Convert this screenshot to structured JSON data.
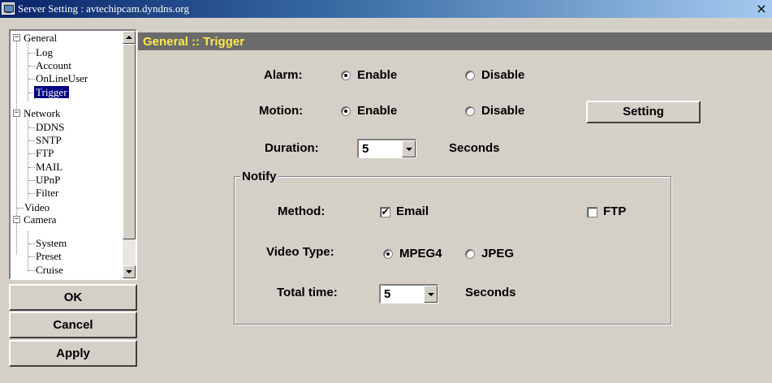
{
  "window": {
    "title": "Server Setting : avtechipcam.dyndns.org",
    "close_glyph": "×",
    "icon": "app-window-icon"
  },
  "tree": {
    "general": {
      "label": "General",
      "expander": "−",
      "children": [
        "Log",
        "Account",
        "OnLineUser",
        "Trigger"
      ]
    },
    "network": {
      "label": "Network",
      "expander": "−",
      "children": [
        "DDNS",
        "SNTP",
        "FTP",
        "MAIL",
        "UPnP",
        "Filter"
      ]
    },
    "video": {
      "label": "Video"
    },
    "camera": {
      "label": "Camera",
      "expander": "−",
      "children": [
        "System",
        "Preset",
        "Cruise"
      ]
    },
    "selected": "Trigger",
    "scroll_position": 0.0
  },
  "side_buttons": {
    "ok": "OK",
    "cancel": "Cancel",
    "apply": "Apply"
  },
  "header": {
    "text": "General :: Trigger",
    "text_color": "#ffe84a",
    "bg_color": "#6b6b6b"
  },
  "form": {
    "alarm": {
      "label": "Alarm:",
      "options": [
        "Enable",
        "Disable"
      ],
      "selected": "Enable"
    },
    "motion": {
      "label": "Motion:",
      "options": [
        "Enable",
        "Disable"
      ],
      "selected": "Enable",
      "button": "Setting"
    },
    "duration": {
      "label": "Duration:",
      "value": "5",
      "unit": "Seconds"
    }
  },
  "notify": {
    "legend": "Notify",
    "method": {
      "label": "Method:",
      "email": {
        "label": "Email",
        "checked": true,
        "mark": "✔"
      },
      "ftp": {
        "label": "FTP",
        "checked": false
      }
    },
    "video_type": {
      "label": "Video Type:",
      "options": [
        "MPEG4",
        "JPEG"
      ],
      "selected": "MPEG4"
    },
    "total_time": {
      "label": "Total time:",
      "value": "5",
      "unit": "Seconds"
    }
  }
}
